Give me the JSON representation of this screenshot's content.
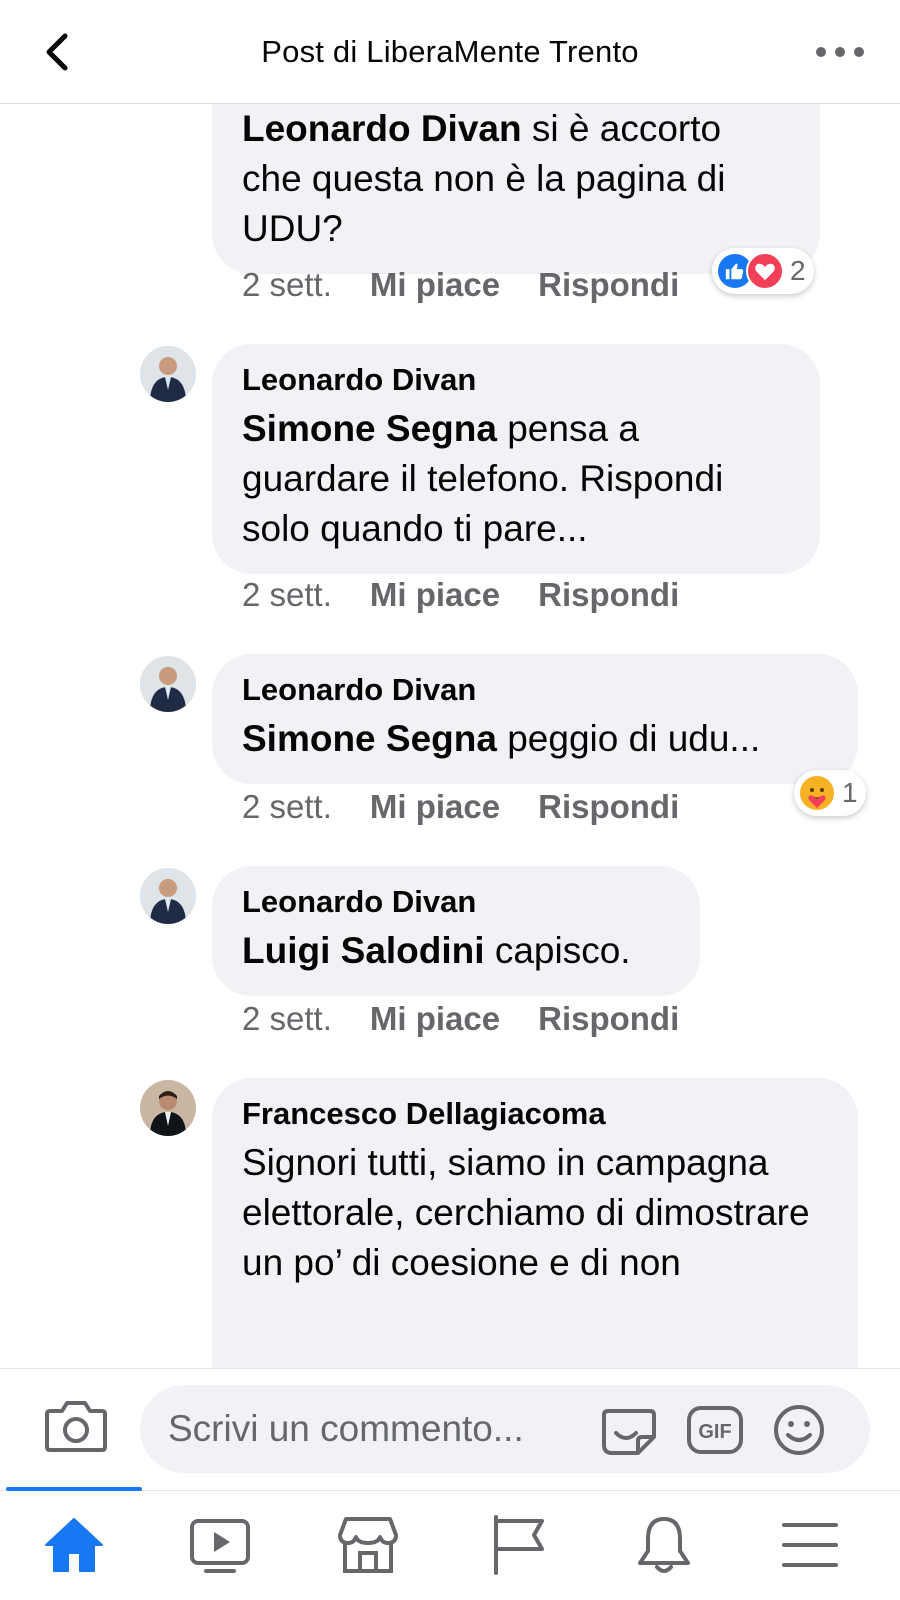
{
  "header": {
    "title": "Post di LiberaMente Trento",
    "back_icon": "chevron-left-icon",
    "more_icon": "more-horizontal-icon"
  },
  "comments": [
    {
      "author": "",
      "mention": "Leonardo Divan",
      "text": " si è accorto che questa non è la pagina di UDU?",
      "time": "2 sett.",
      "like": "Mi piace",
      "reply": "Rispondi",
      "reactions": {
        "icons": [
          "like-icon",
          "love-icon"
        ],
        "count": "2"
      }
    },
    {
      "author": "Leonardo Divan",
      "mention": "Simone Segna",
      "text": " pensa a guardare il telefono. Rispondi solo quando ti pare...",
      "time": "2 sett.",
      "like": "Mi piace",
      "reply": "Rispondi"
    },
    {
      "author": "Leonardo Divan",
      "mention": "Simone Segna",
      "text": " peggio di udu...",
      "time": "2 sett.",
      "like": "Mi piace",
      "reply": "Rispondi",
      "reactions": {
        "icons": [
          "care-icon"
        ],
        "count": "1"
      }
    },
    {
      "author": "Leonardo Divan",
      "mention": "Luigi Salodini",
      "text": " capisco.",
      "time": "2 sett.",
      "like": "Mi piace",
      "reply": "Rispondi"
    },
    {
      "author": "Francesco Dellagiacoma",
      "mention": "",
      "text": "Signori tutti, siamo in campagna elettorale, cerchiamo di dimostrare un po’ di coesione e di non"
    }
  ],
  "composer": {
    "placeholder": "Scrivi un commento...",
    "icons": [
      "camera-icon",
      "sticker-icon",
      "gif-icon",
      "emoji-icon"
    ],
    "gif_label": "GIF"
  },
  "nav": {
    "items": [
      "home-icon",
      "video-icon",
      "marketplace-icon",
      "pages-flag-icon",
      "notifications-bell-icon",
      "menu-icon"
    ],
    "active": "home-icon",
    "accent_color": "#1877f2"
  },
  "colors": {
    "bubble": "#f0f2f5",
    "secondary_text": "#65676b",
    "like_blue": "#1877f2",
    "love_red": "#f33e58"
  }
}
